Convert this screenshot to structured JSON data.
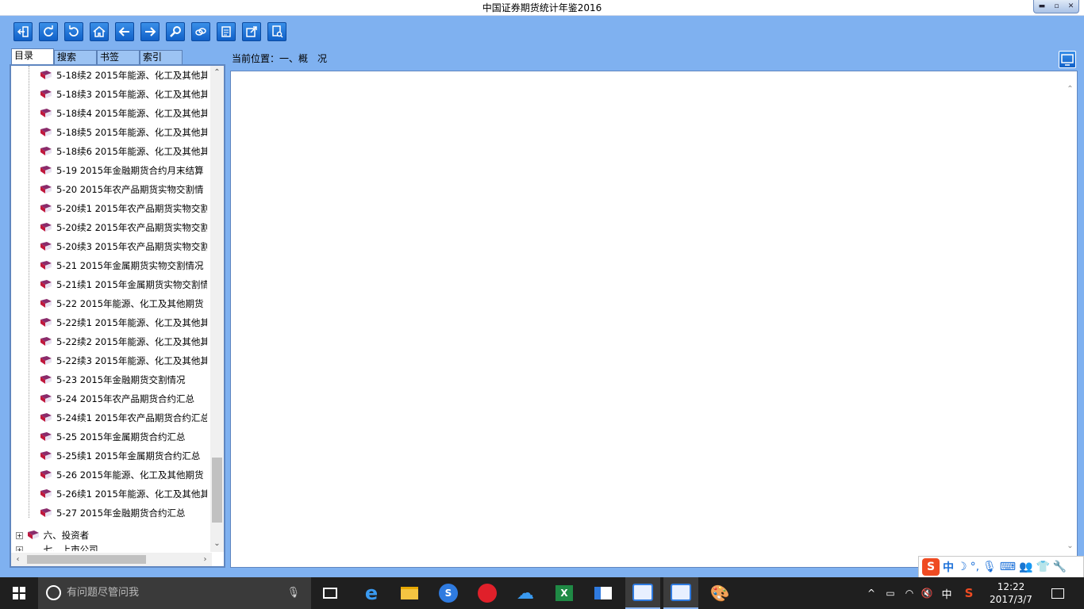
{
  "window": {
    "title": "中国证券期货统计年鉴2016"
  },
  "tabs": [
    {
      "label": "目录",
      "active": true
    },
    {
      "label": "搜索",
      "active": false
    },
    {
      "label": "书签",
      "active": false
    },
    {
      "label": "索引",
      "active": false
    }
  ],
  "tree": {
    "items": [
      "5-18续2 2015年能源、化工及其他其",
      "5-18续3 2015年能源、化工及其他其",
      "5-18续4 2015年能源、化工及其他其",
      "5-18续5 2015年能源、化工及其他其",
      "5-18续6 2015年能源、化工及其他其",
      "5-19 2015年金融期货合约月末结算",
      "5-20 2015年农产品期货实物交割情",
      "5-20续1 2015年农产品期货实物交割",
      "5-20续2 2015年农产品期货实物交割",
      "5-20续3 2015年农产品期货实物交割",
      "5-21 2015年金属期货实物交割情况",
      "5-21续1 2015年金属期货实物交割情",
      "5-22 2015年能源、化工及其他期货",
      "5-22续1 2015年能源、化工及其他其",
      "5-22续2 2015年能源、化工及其他其",
      "5-22续3 2015年能源、化工及其他其",
      "5-23 2015年金融期货交割情况",
      "5-24 2015年农产品期货合约汇总",
      "5-24续1 2015年农产品期货合约汇总",
      "5-25 2015年金属期货合约汇总",
      "5-25续1 2015年金属期货合约汇总",
      "5-26 2015年能源、化工及其他期货",
      "5-26续1 2015年能源、化工及其他其",
      "5-27 2015年金融期货合约汇总"
    ],
    "sections": [
      {
        "label": "六、投资者"
      },
      {
        "label": "七、上市公司"
      }
    ]
  },
  "breadcrumb": {
    "text": "当前位置：一、概　况"
  },
  "ime": {
    "logo": "S",
    "mode": "中"
  },
  "taskbar": {
    "search_placeholder": "有问题尽管问我",
    "ime_indicator": "中",
    "time": "12:22",
    "date": "2017/3/7"
  },
  "colors": {
    "chrome": "#7fb1f0",
    "tool_button": "#1a73d8",
    "book_icon": "#c0183c",
    "taskbar": "#1f1f1f"
  }
}
